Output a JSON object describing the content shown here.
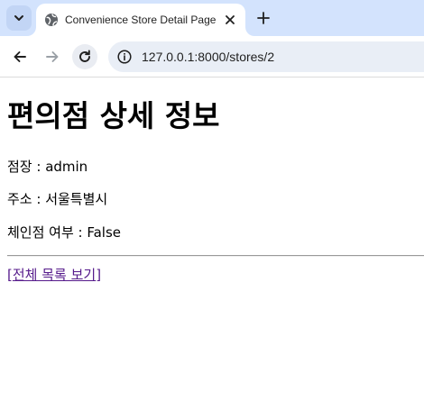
{
  "browser": {
    "tab": {
      "title": "Convenience Store Detail Page"
    },
    "address_bar": {
      "url": "127.0.0.1:8000/stores/2"
    },
    "icons": {
      "tab_search": "chevron-down-icon",
      "favicon": "globe-icon",
      "tab_close": "close-icon",
      "new_tab": "plus-icon",
      "back": "arrow-left-icon",
      "forward": "arrow-right-icon",
      "reload": "reload-icon",
      "site_info": "info-icon"
    }
  },
  "page": {
    "title": "편의점 상세 정보",
    "owner_line": "점장 : admin",
    "address_line": "주소 : 서울특별시",
    "chain_line": "체인점 여부 : False",
    "link_open": "[",
    "link_text": "전체 목록 보기",
    "link_close": "]"
  },
  "colors": {
    "tabstrip_bg": "#d3e3fd",
    "omnibox_bg": "#e9eef6",
    "visited_link": "#551a8b"
  }
}
